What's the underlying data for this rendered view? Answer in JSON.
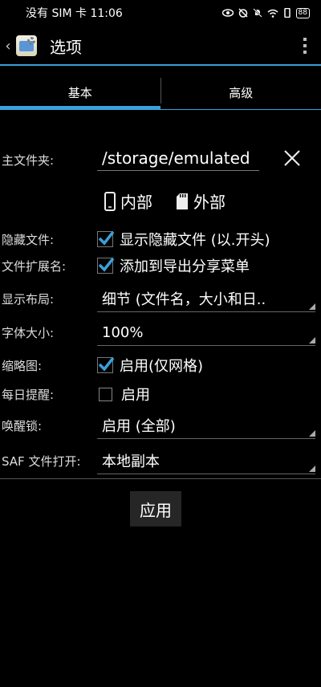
{
  "status_bar": {
    "text": "没有 SIM 卡 11:06",
    "battery": "88"
  },
  "app_bar": {
    "title": "选项"
  },
  "tabs": [
    {
      "label": "基本",
      "active": true
    },
    {
      "label": "高级",
      "active": false
    }
  ],
  "form": {
    "main_folder": {
      "label": "主文件夹:",
      "value": "/storage/emulated"
    },
    "storage": {
      "internal": "内部",
      "external": "外部"
    },
    "hidden_files": {
      "label": "隐藏文件:",
      "option": "显示隐藏文件 (以.开头)",
      "checked": true
    },
    "file_extension": {
      "label": "文件扩展名:",
      "option": "添加到导出分享菜单",
      "checked": true
    },
    "display_layout": {
      "label": "显示布局:",
      "value": "细节 (文件名，大小和日.."
    },
    "font_size": {
      "label": "字体大小:",
      "value": "100%"
    },
    "thumbnails": {
      "label": "缩略图:",
      "option": "启用(仅网格)",
      "checked": true
    },
    "daily_reminder": {
      "label": "每日提醒:",
      "option": "启用",
      "checked": false
    },
    "wake_lock": {
      "label": "唤醒锁:",
      "value": "启用 (全部)"
    },
    "saf_open": {
      "label": "SAF 文件打开:",
      "value": "本地副本"
    }
  },
  "apply_button": "应用",
  "colors": {
    "accent": "#3aa0d8",
    "checkmark": "#3aa0d8"
  }
}
